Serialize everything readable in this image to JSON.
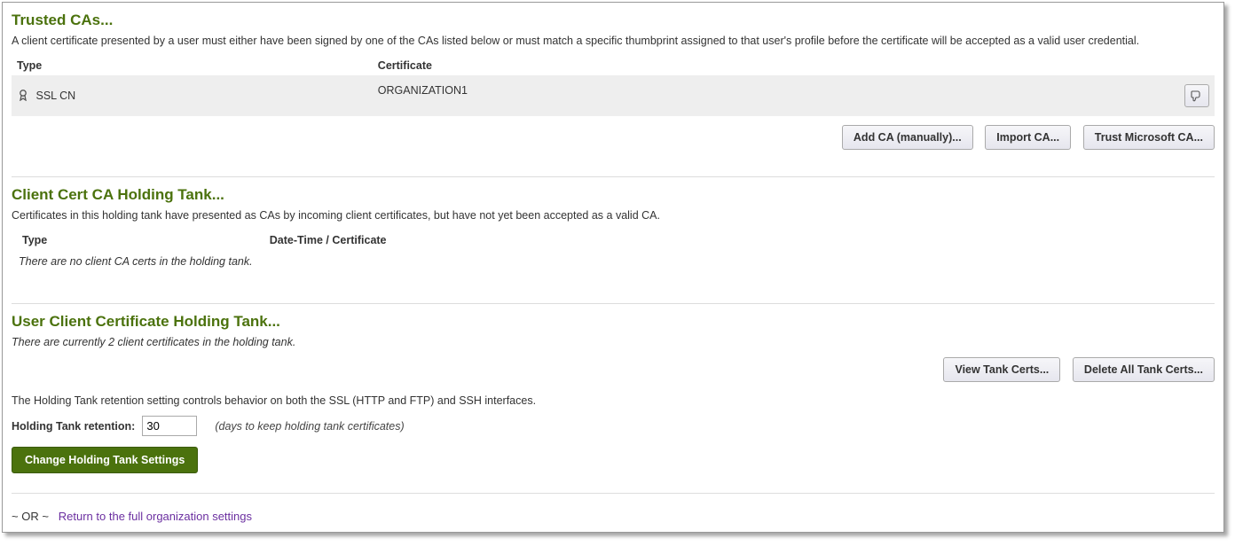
{
  "trusted": {
    "title": "Trusted CAs...",
    "description": "A client certificate presented by a user must either have been signed by one of the CAs listed below or must match a specific thumbprint assigned to that user's profile before the certificate will be accepted as a valid user credential.",
    "col_type": "Type",
    "col_cert": "Certificate",
    "row_type": "SSL CN",
    "row_cert": "ORGANIZATION1",
    "btn_add": "Add CA (manually)...",
    "btn_import": "Import CA...",
    "btn_trustms": "Trust Microsoft CA..."
  },
  "holding_ca": {
    "title": "Client Cert CA Holding Tank...",
    "description": "Certificates in this holding tank have presented as CAs by incoming client certificates, but have not yet been accepted as a valid CA.",
    "col_type": "Type",
    "col_datecert": "Date-Time / Certificate",
    "empty": "There are no client CA certs in the holding tank."
  },
  "holding_user": {
    "title": "User Client Certificate Holding Tank...",
    "status": "There are currently 2 client certificates in the holding tank.",
    "btn_view": "View Tank Certs...",
    "btn_delete": "Delete All Tank Certs...",
    "retention_desc": "The Holding Tank retention setting controls behavior on both the SSL (HTTP and FTP) and SSH interfaces.",
    "retention_label": "Holding Tank retention:",
    "retention_value": "30",
    "retention_hint": "(days to keep holding tank certificates)",
    "btn_change": "Change Holding Tank Settings"
  },
  "footer": {
    "or": "~ OR ~",
    "link": "Return to the full organization settings"
  }
}
